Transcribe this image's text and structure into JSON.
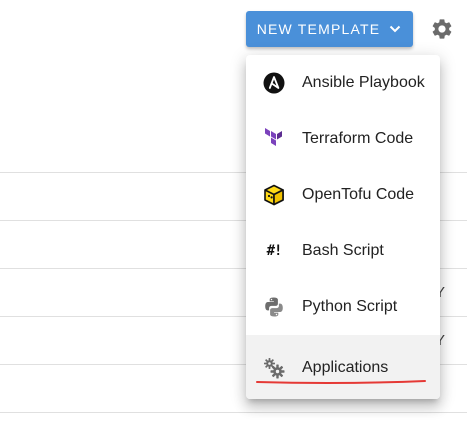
{
  "toolbar": {
    "new_template_label": "NEW TEMPLATE",
    "accent_color": "#4a90d9"
  },
  "menu": {
    "items": [
      {
        "label": "Ansible Playbook",
        "icon": "ansible-icon"
      },
      {
        "label": "Terraform Code",
        "icon": "terraform-icon"
      },
      {
        "label": "OpenTofu Code",
        "icon": "opentofu-icon"
      },
      {
        "label": "Bash Script",
        "icon": "bash-icon",
        "glyph": "#!"
      },
      {
        "label": "Python Script",
        "icon": "python-icon"
      },
      {
        "label": "Applications",
        "icon": "gears-icon"
      }
    ],
    "highlighted_index": 5
  },
  "background": {
    "partial_cell_text": [
      "Y",
      "Y"
    ]
  },
  "colors": {
    "annotation_underline": "#e53935",
    "terraform": "#7b42bc",
    "opentofu": "#ffda18",
    "icon_gray": "#666666"
  }
}
